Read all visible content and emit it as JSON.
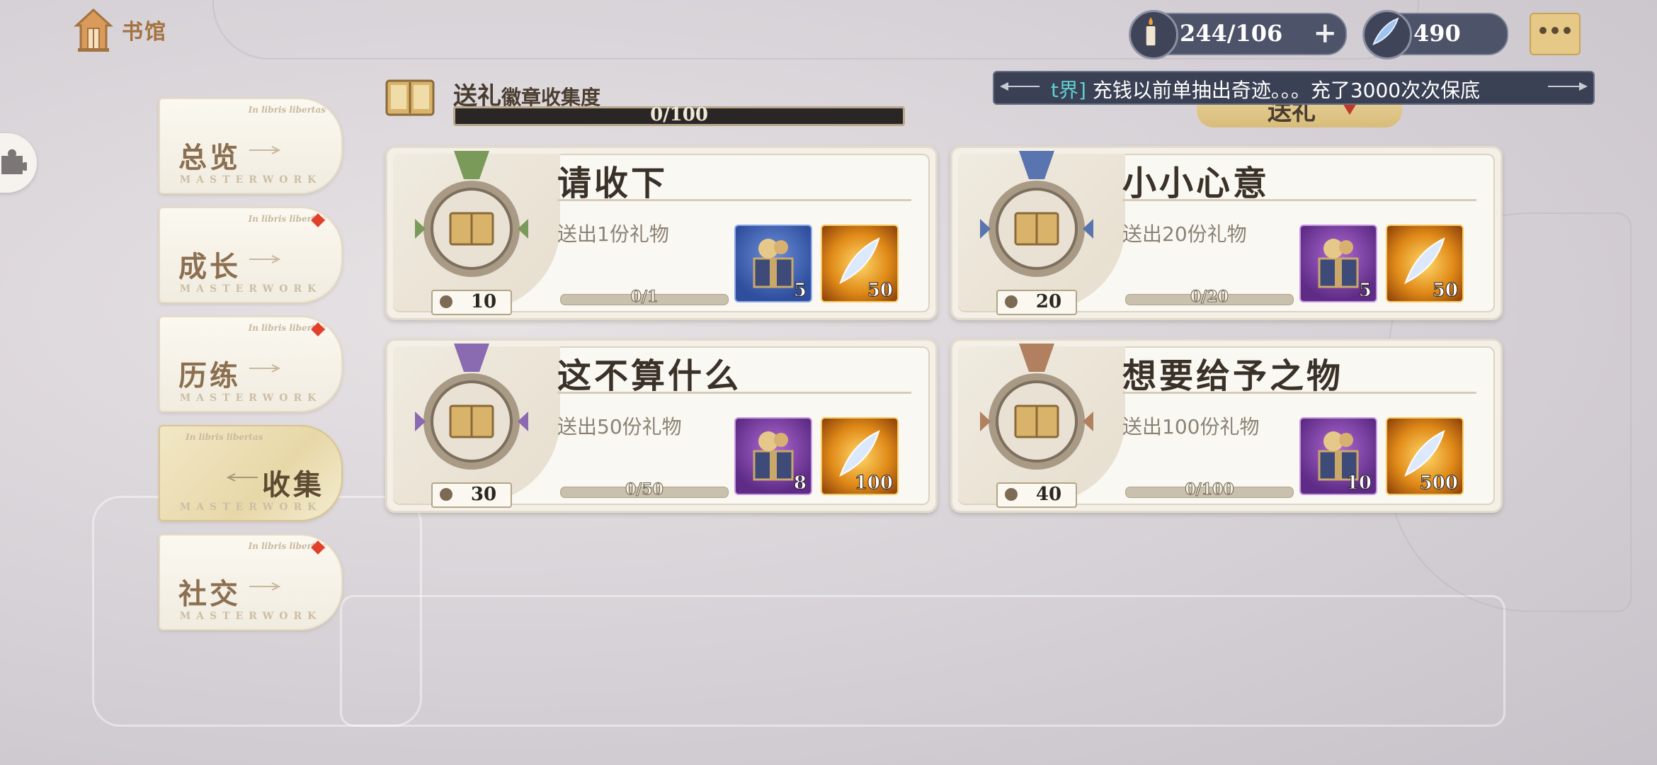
{
  "header": {
    "home_label": "书馆"
  },
  "resources": {
    "stamina": "244/106",
    "crystal": "490"
  },
  "marquee": {
    "tag": "[世界]",
    "visible_tag": "t界]",
    "message": "充钱以前单抽出奇迹。。。充了3000次次保底"
  },
  "filter": {
    "label": "送礼"
  },
  "progress": {
    "title_main": "送礼",
    "title_sub": "徽章收集度",
    "value": "0/100",
    "current": 0,
    "total": 100
  },
  "tabs": [
    {
      "label": "总览",
      "tiny": "In libris libertas",
      "footer": "MASTERWORK",
      "badge": false,
      "active": false
    },
    {
      "label": "成长",
      "tiny": "In libris libertas",
      "footer": "MASTERWORK",
      "badge": true,
      "active": false
    },
    {
      "label": "历练",
      "tiny": "In libris libertas",
      "footer": "MASTERWORK",
      "badge": true,
      "active": false
    },
    {
      "label": "收集",
      "tiny": "In libris libertas",
      "footer": "MASTERWORK",
      "badge": false,
      "active": true
    },
    {
      "label": "社交",
      "tiny": "In libris libertas",
      "footer": "MASTERWORK",
      "badge": true,
      "active": false
    }
  ],
  "cards": [
    {
      "title": "请收下",
      "desc": "送出1份礼物",
      "level": "10",
      "progress": "0/1",
      "ribbon": "#7a9a5a",
      "reward1_color": "blue",
      "reward1": "5",
      "reward2": "50"
    },
    {
      "title": "小小心意",
      "desc": "送出20份礼物",
      "level": "20",
      "progress": "0/20",
      "ribbon": "#5a74b0",
      "reward1_color": "purple",
      "reward1": "5",
      "reward2": "50"
    },
    {
      "title": "这不算什么",
      "desc": "送出50份礼物",
      "level": "30",
      "progress": "0/50",
      "ribbon": "#8a6ab0",
      "reward1_color": "purple",
      "reward1": "8",
      "reward2": "100"
    },
    {
      "title": "想要给予之物",
      "desc": "送出100份礼物",
      "level": "40",
      "progress": "0/100",
      "ribbon": "#b08060",
      "reward1_color": "purple",
      "reward1": "10",
      "reward2": "500"
    }
  ],
  "icons": {
    "home": "library-house-icon",
    "stamina": "candle-icon",
    "crystal": "feather-crystal-icon",
    "chat": "chat-bubble-icon",
    "side": "puzzle-icon",
    "book": "open-book-icon",
    "gift": "gift-box-icon",
    "feather": "feather-icon"
  }
}
